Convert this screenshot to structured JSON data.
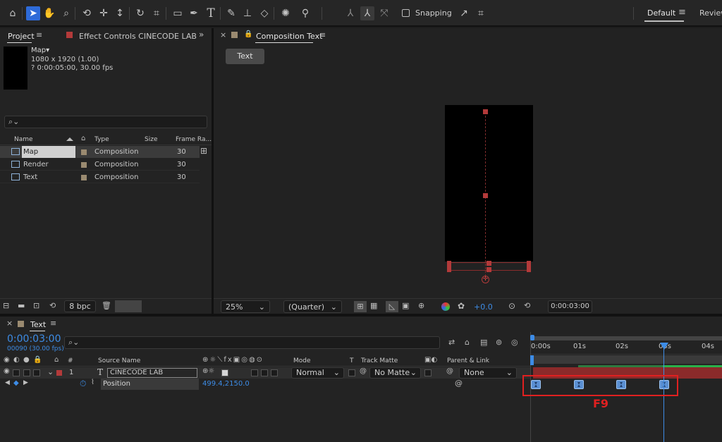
{
  "toolbar": {
    "tools": [
      "home-icon",
      "selection-tool-icon",
      "hand-tool-icon",
      "zoom-tool-icon",
      "orbit-camera-icon",
      "pan-camera-icon",
      "dolly-camera-icon",
      "rotate-tool-icon",
      "pan-behind-icon",
      "rectangle-tool-icon",
      "pen-tool-icon",
      "type-tool-icon",
      "brush-tool-icon",
      "clone-stamp-icon",
      "eraser-tool-icon",
      "roto-brush-icon",
      "puppet-pin-icon"
    ],
    "snapping_label": "Snapping",
    "workspace_default": "Default",
    "workspace_review": "Review"
  },
  "project": {
    "tab_label": "Project",
    "effect_controls_label": "Effect Controls CINECODE LAB",
    "selected_name": "Map▾",
    "selected_dims": "1080 x 1920 (1.00)",
    "selected_duration": "? 0:00:05:00, 30.00 fps",
    "search_placeholder": "",
    "columns": {
      "name": "Name",
      "type": "Type",
      "size": "Size",
      "frame_rate": "Frame Ra..."
    },
    "items": [
      {
        "name": "Map",
        "type": "Composition",
        "fps": "30"
      },
      {
        "name": "Render",
        "type": "Composition",
        "fps": "30"
      },
      {
        "name": "Text",
        "type": "Composition",
        "fps": "30"
      }
    ],
    "bpc": "8 bpc"
  },
  "composition": {
    "tab_label": "Composition Text",
    "breadcrumb": "Text",
    "zoom": "25%",
    "resolution": "(Quarter)",
    "exposure": "+0.0",
    "timecode": "0:00:03:00"
  },
  "timeline": {
    "tab_label": "Text",
    "current_time": "0:00:03:00",
    "frame_info": "00090 (30.00 fps)",
    "headers": {
      "num": "#",
      "source_name": "Source Name",
      "mode": "Mode",
      "t": "T",
      "track_matte": "Track Matte",
      "parent": "Parent & Link"
    },
    "layer": {
      "index": "1",
      "type_icon": "T",
      "name": "CINECODE LAB",
      "mode": "Normal",
      "matte": "No Matte",
      "parent": "None"
    },
    "property": {
      "name": "Position",
      "value": "499.4,2150.0"
    },
    "ruler": [
      "0:00s",
      "01s",
      "02s",
      "03s",
      "04s"
    ],
    "annotation": "F9",
    "annotation_color": "#e02020",
    "playhead_color": "#3d8ce6"
  }
}
